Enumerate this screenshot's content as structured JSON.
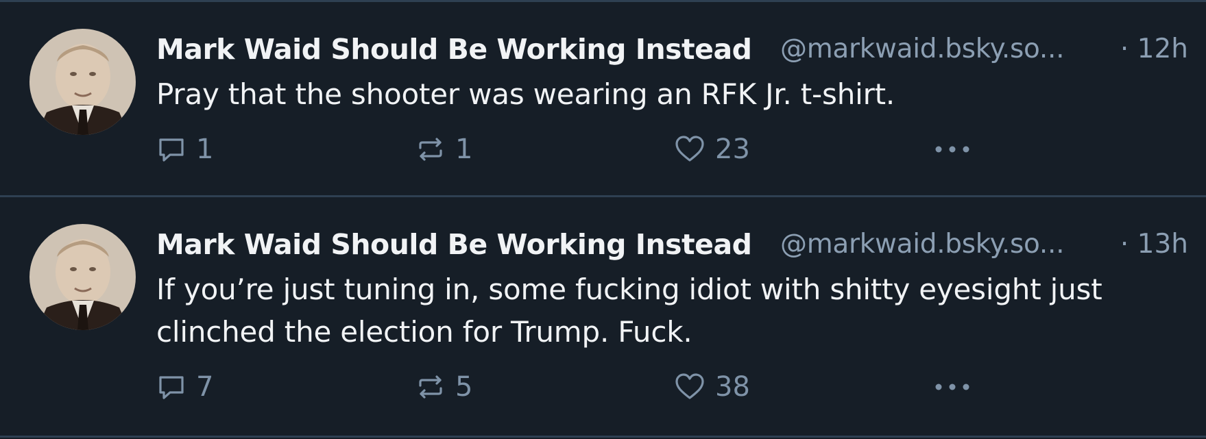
{
  "colors": {
    "background": "#161e27",
    "divider": "#2e4052",
    "primary_text": "#f1f3f5",
    "secondary_text": "#8c9fb3",
    "icon": "#7f93a8"
  },
  "posts": [
    {
      "author_name": "Mark Waid Should Be Working Instead",
      "handle": "@markwaid.bsky.so...",
      "time": "· 12h",
      "text": "Pray that the shooter was wearing an RFK Jr. t-shirt.",
      "replies": "1",
      "reposts": "1",
      "likes": "23"
    },
    {
      "author_name": "Mark Waid Should Be Working Instead",
      "handle": "@markwaid.bsky.so...",
      "time": "· 13h",
      "text": "If you’re just tuning in, some fucking idiot with shitty eyesight just clinched the election for Trump. Fuck.",
      "replies": "7",
      "reposts": "5",
      "likes": "38"
    }
  ],
  "icons": {
    "avatar": "avatar-photo",
    "reply": "speech-bubble-icon",
    "repost": "repost-arrows-icon",
    "like": "heart-icon",
    "more": "ellipsis-icon"
  }
}
